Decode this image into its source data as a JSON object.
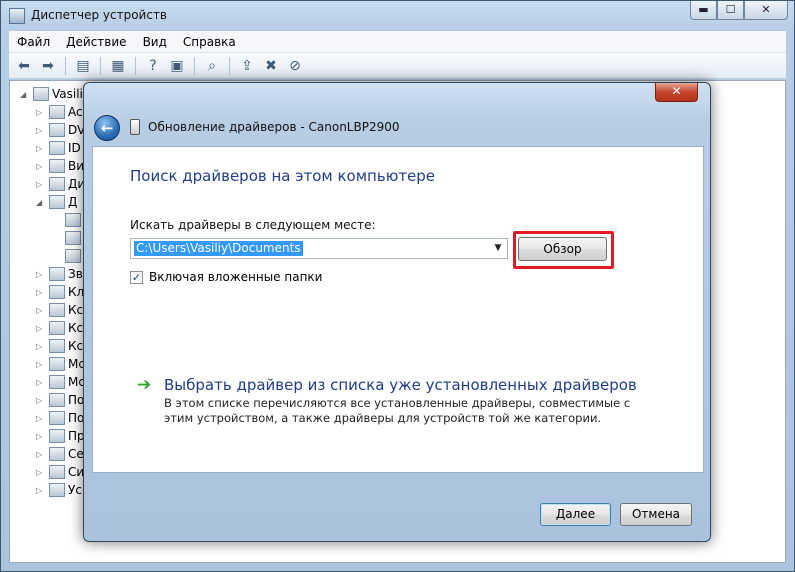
{
  "main_window": {
    "title": "Диспетчер устройств",
    "caption": {
      "minimize": "▬",
      "maximize": "☐",
      "close": "✕"
    },
    "menu": [
      "Файл",
      "Действие",
      "Вид",
      "Справка"
    ],
    "tree": [
      {
        "label": "Vasiliy",
        "expander": "◢"
      },
      {
        "label": "Ac",
        "expander": "▷"
      },
      {
        "label": "DV",
        "expander": "▷"
      },
      {
        "label": "ID",
        "expander": "▷"
      },
      {
        "label": "Ви",
        "expander": "▷"
      },
      {
        "label": "Ди",
        "expander": "▷"
      },
      {
        "label": "Д",
        "expander": "◢"
      },
      {
        "label": "",
        "expander": ""
      },
      {
        "label": "",
        "expander": ""
      },
      {
        "label": "",
        "expander": ""
      },
      {
        "label": "Зв",
        "expander": "▷"
      },
      {
        "label": "Кл",
        "expander": "▷"
      },
      {
        "label": "Кс",
        "expander": "▷"
      },
      {
        "label": "Кс",
        "expander": "▷"
      },
      {
        "label": "Кс",
        "expander": "▷"
      },
      {
        "label": "Мс",
        "expander": "▷"
      },
      {
        "label": "Мс",
        "expander": "▷"
      },
      {
        "label": "По",
        "expander": "▷"
      },
      {
        "label": "По",
        "expander": "▷"
      },
      {
        "label": "Пр",
        "expander": "▷"
      },
      {
        "label": "Се",
        "expander": "▷"
      },
      {
        "label": "Си",
        "expander": "▷"
      },
      {
        "label": "Ус",
        "expander": "▷"
      }
    ]
  },
  "dialog": {
    "close_glyph": "✕",
    "back_glyph": "←",
    "title": "Обновление драйверов - CanonLBP2900",
    "heading": "Поиск драйверов на этом компьютере",
    "path_label": "Искать драйверы в следующем месте:",
    "path_value": "C:\\Users\\Vasiliy\\Documents",
    "browse_label": "Обзор",
    "include_subfolders": {
      "label": "Включая вложенные папки",
      "checked": true,
      "glyph": "✓"
    },
    "pick_link": "Выбрать драйвер из списка уже установленных драйверов",
    "pick_desc": "В этом списке перечисляются все установленные драйверы, совместимые с этим устройством, а также драйверы для устройств той же категории.",
    "next_label": "Далее",
    "cancel_label": "Отмена"
  },
  "colors": {
    "highlight": "#e01b24",
    "heading": "#1f3d8a",
    "selection": "#3399ff"
  }
}
